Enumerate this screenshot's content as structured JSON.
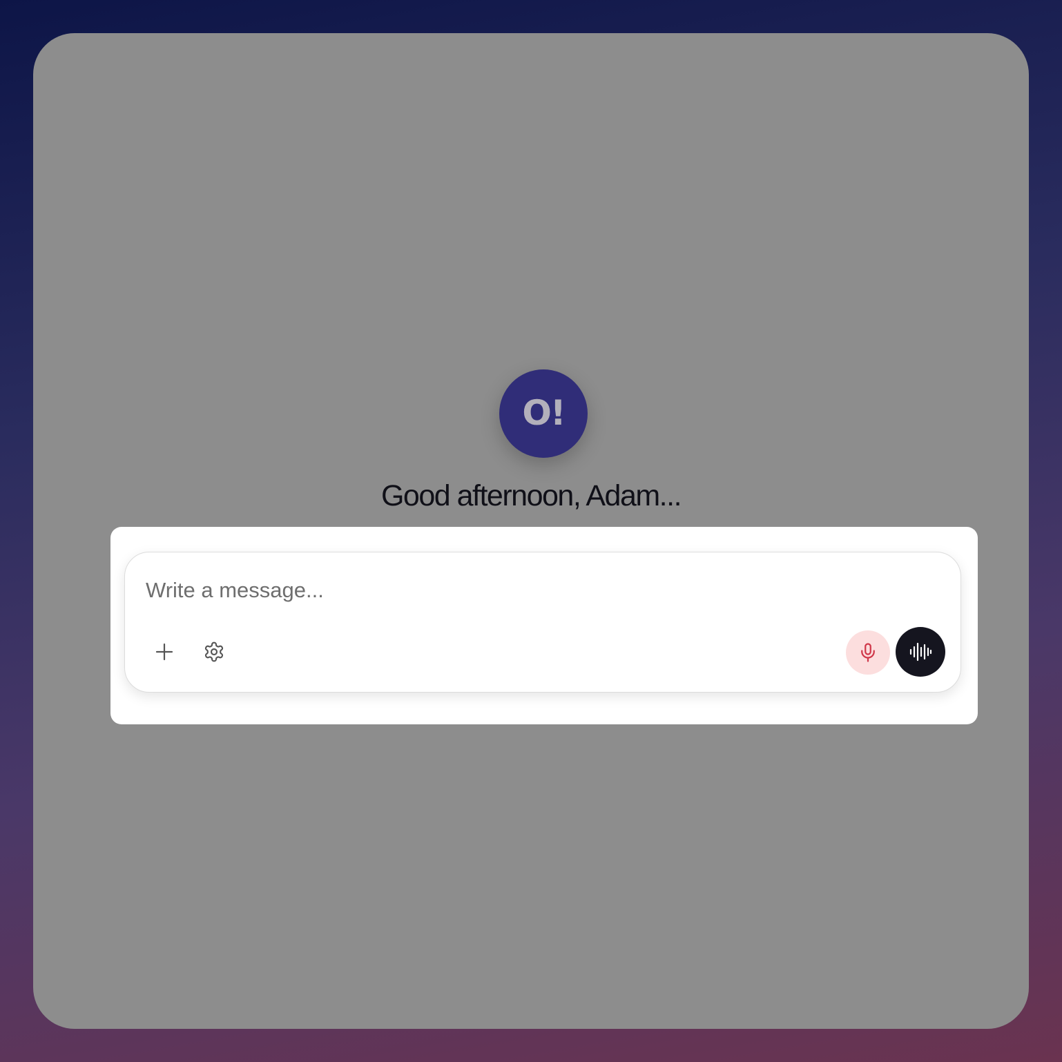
{
  "app": {
    "logo_text": "O!",
    "greeting": "Good afternoon, Adam..."
  },
  "composer": {
    "placeholder": "Write a message...",
    "value": "",
    "buttons": {
      "attach_icon": "plus-icon",
      "settings_icon": "gear-icon",
      "mic_icon": "microphone-icon",
      "voice_icon": "audio-waveform-icon"
    }
  },
  "colors": {
    "logo_bg": "#302d78",
    "mic_bg": "#fcdede",
    "mic_icon": "#d0384a",
    "voice_bg": "#15151f"
  }
}
